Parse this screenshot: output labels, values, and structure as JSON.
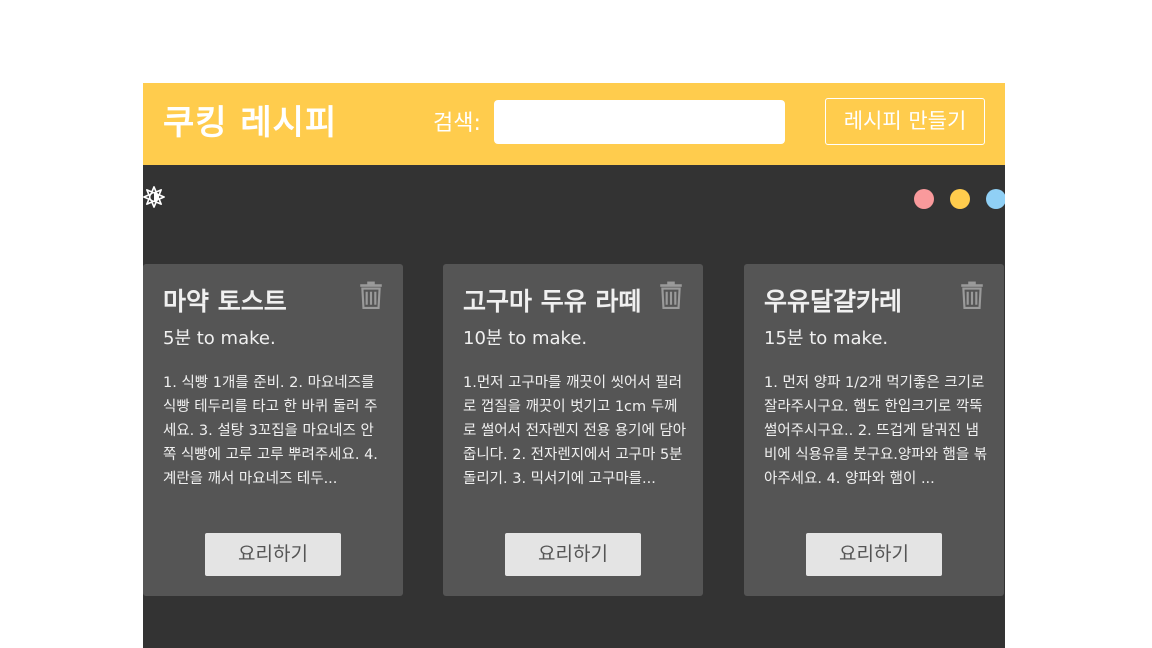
{
  "header": {
    "title": "쿠킹 레시피",
    "search_label": "검색:",
    "search_value": "",
    "search_placeholder": "",
    "create_button": "레시피 만들기"
  },
  "theme": {
    "toggle_icon": "gear-icon",
    "colors": [
      "#f99a9c",
      "#ffcc4d",
      "#90d0f5"
    ]
  },
  "recipes": [
    {
      "title": "마약 토스트",
      "time": "5분",
      "time_suffix": " to make.",
      "method": "1. 식빵 1개를 준비. 2. 마요네즈를 식빵 테두리를 타고 한 바퀴 둘러 주세요. 3. 설탕 3꼬집을 마요네즈 안쪽 식빵에 고루 고루 뿌려주세요. 4. 계란을 깨서 마요네즈 테두...",
      "cook_button": "요리하기"
    },
    {
      "title": "고구마 두유 라떼",
      "time": "10분",
      "time_suffix": " to make.",
      "method": "1.먼저 고구마를 깨끗이 씻어서 필러로 껍질을 깨끗이 벗기고 1cm 두께로 썰어서 전자렌지 전용 용기에 담아 줍니다. 2. 전자렌지에서 고구마 5분 돌리기. 3. 믹서기에 고구마를...",
      "cook_button": "요리하기"
    },
    {
      "title": "우유달걀카레",
      "time": "15분",
      "time_suffix": " to make.",
      "method": "1. 먼저 양파 1/2개 먹기좋은 크기로 잘라주시구요. 햄도 한입크기로 깍뚝 썰어주시구요.. 2. 뜨겁게 달궈진 냄비에 식용유를 붓구요.양파와 햄을 볶아주세요. 4. 양파와 햄이 ...",
      "cook_button": "요리하기"
    }
  ]
}
